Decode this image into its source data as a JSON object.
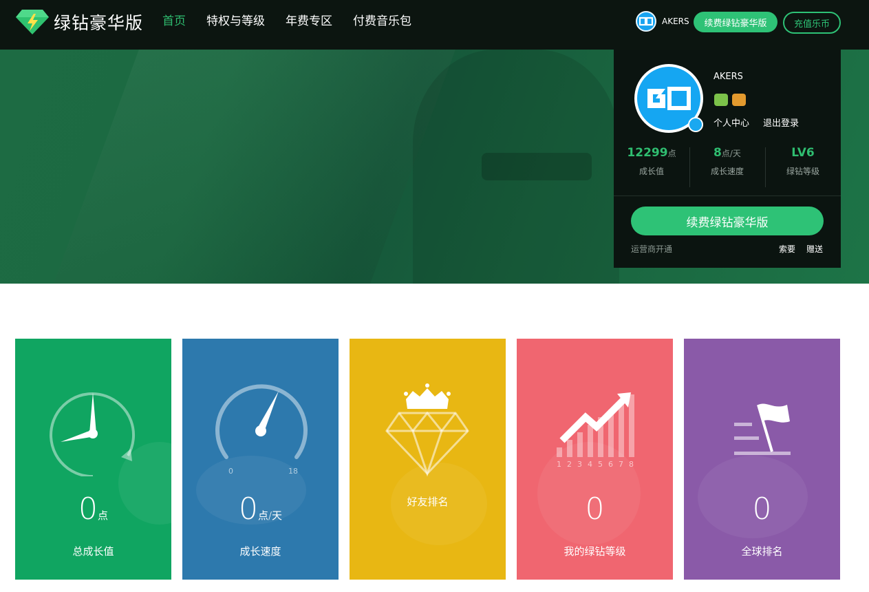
{
  "brand": {
    "name": "绿钻豪华版"
  },
  "nav": [
    {
      "label": "首页",
      "active": true
    },
    {
      "label": "特权与等级"
    },
    {
      "label": "年费专区"
    },
    {
      "label": "付费音乐包"
    }
  ],
  "header": {
    "username": "AKERS",
    "renew_label": "续费绿钻豪华版",
    "recharge_label": "充值乐币"
  },
  "panel": {
    "username": "AKERS",
    "links": {
      "center": "个人中心",
      "logout": "退出登录"
    },
    "stats": [
      {
        "value": "12299",
        "unit": "点",
        "label": "成长值"
      },
      {
        "value": "8",
        "unit": "点/天",
        "label": "成长速度"
      },
      {
        "value": "LV6",
        "unit": "",
        "label": "绿钻等级"
      }
    ],
    "renew_button": "续费绿钻豪华版",
    "operator": "运营商开通",
    "ask": "索要",
    "give": "赠送"
  },
  "cards": [
    {
      "value": "0",
      "unit": "点",
      "label": "总成长值",
      "color": "#10a561"
    },
    {
      "value": "0",
      "unit": "点/天",
      "label": "成长速度",
      "color": "#2d79ad",
      "gauge_min": "0",
      "gauge_max": "18"
    },
    {
      "label": "好友排名",
      "color": "#e8b713"
    },
    {
      "value": "0",
      "label": "我的绿钻等级",
      "color": "#f06670",
      "bars": [
        "1",
        "2",
        "3",
        "4",
        "5",
        "6",
        "7",
        "8"
      ]
    },
    {
      "value": "0",
      "label": "全球排名",
      "color": "#8a5aa8"
    }
  ],
  "colors": {
    "accent": "#2ec276",
    "topbar": "#0c1510",
    "panel": "#0b1410"
  }
}
